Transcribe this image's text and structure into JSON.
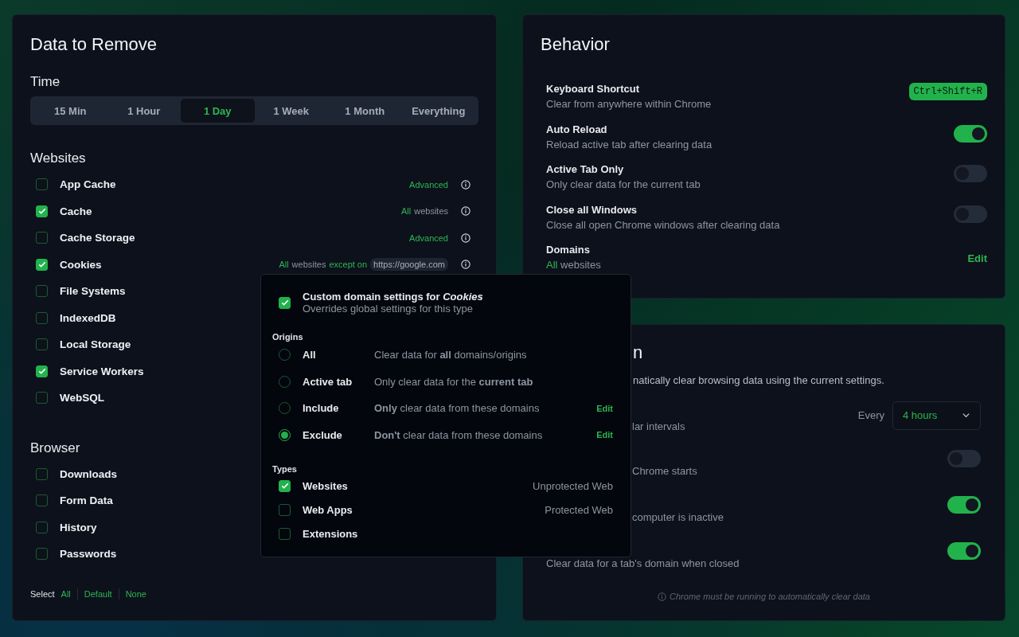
{
  "remove_panel": {
    "title": "Data to Remove",
    "time": {
      "heading": "Time",
      "options": [
        {
          "label": "15 Min",
          "selected": false
        },
        {
          "label": "1 Hour",
          "selected": false
        },
        {
          "label": "1 Day",
          "selected": true
        },
        {
          "label": "1 Week",
          "selected": false
        },
        {
          "label": "1 Month",
          "selected": false
        },
        {
          "label": "Everything",
          "selected": false
        }
      ]
    },
    "websites": {
      "heading": "Websites",
      "items": [
        {
          "label": "App Cache",
          "checked": false,
          "note": [
            {
              "kind": "accent",
              "text": "Advanced"
            }
          ]
        },
        {
          "label": "Cache",
          "checked": true,
          "note": [
            {
              "kind": "accent",
              "text": "All"
            },
            {
              "kind": "muted",
              "text": "websites"
            }
          ]
        },
        {
          "label": "Cache Storage",
          "checked": false,
          "note": [
            {
              "kind": "accent",
              "text": "Advanced"
            }
          ]
        },
        {
          "label": "Cookies",
          "checked": true,
          "note": [
            {
              "kind": "accent",
              "text": "All"
            },
            {
              "kind": "muted",
              "text": "websites"
            },
            {
              "kind": "accent",
              "text": "except on"
            },
            {
              "kind": "chip",
              "text": "https://google.com"
            }
          ]
        },
        {
          "label": "File Systems",
          "checked": false
        },
        {
          "label": "IndexedDB",
          "checked": false
        },
        {
          "label": "Local Storage",
          "checked": false
        },
        {
          "label": "Service Workers",
          "checked": true
        },
        {
          "label": "WebSQL",
          "checked": false
        }
      ]
    },
    "browser": {
      "heading": "Browser",
      "items": [
        {
          "label": "Downloads",
          "checked": false
        },
        {
          "label": "Form Data",
          "checked": false
        },
        {
          "label": "History",
          "checked": false
        },
        {
          "label": "Passwords",
          "checked": false
        }
      ]
    },
    "select": {
      "label": "Select",
      "links": [
        "All",
        "Default",
        "None"
      ]
    }
  },
  "behavior_panel": {
    "title": "Behavior",
    "settings": [
      {
        "kind": "shortcut",
        "title": "Keyboard Shortcut",
        "description": "Clear from anywhere within Chrome",
        "shortcut": "Ctrl+Shift+R"
      },
      {
        "kind": "toggle",
        "title": "Auto Reload",
        "description": "Reload active tab after clearing data",
        "on": true
      },
      {
        "kind": "toggle",
        "title": "Active Tab Only",
        "description": "Only clear data for the current tab",
        "on": false
      },
      {
        "kind": "toggle",
        "title": "Close all Windows",
        "description": "Close all open Chrome windows after clearing data",
        "on": false
      },
      {
        "kind": "link",
        "title": "Domains",
        "accent": "All",
        "description": "websites",
        "action": "Edit"
      }
    ]
  },
  "automation_panel": {
    "title": "n",
    "description": "natically clear browsing data using the current settings.",
    "rows": [
      {
        "kind": "interval",
        "text": "lar intervals",
        "clipped": true,
        "prefix": "Every",
        "value": "4 hours"
      },
      {
        "kind": "toggle",
        "text": "Chrome starts",
        "clipped": true,
        "on": false
      },
      {
        "kind": "toggle",
        "text": "computer is inactive",
        "clipped": true,
        "on": true
      },
      {
        "kind": "toggle",
        "text": "Clear data for a tab's domain when closed",
        "clipped": false,
        "on": true
      }
    ],
    "note": "Chrome must be running to automatically clear data"
  },
  "popup": {
    "checked": true,
    "title": "Custom domain settings for *Cookies*",
    "subtitle": "Overrides global settings for this type",
    "origins": {
      "heading": "Origins",
      "options": [
        {
          "label": "All",
          "description": "Clear data for **all** domains/origins",
          "selected": false
        },
        {
          "label": "Active tab",
          "description": "Only clear data for the **current tab**",
          "selected": false
        },
        {
          "label": "Include",
          "description": "**Only** clear data from these domains",
          "selected": false,
          "action": "Edit"
        },
        {
          "label": "Exclude",
          "description": "**Don't** clear data from these domains",
          "selected": true,
          "action": "Edit"
        }
      ]
    },
    "types": {
      "heading": "Types",
      "items": [
        {
          "label": "Websites",
          "checked": true,
          "note": "Unprotected Web"
        },
        {
          "label": "Web Apps",
          "checked": false,
          "note": "Protected Web"
        },
        {
          "label": "Extensions",
          "checked": false
        }
      ]
    }
  }
}
